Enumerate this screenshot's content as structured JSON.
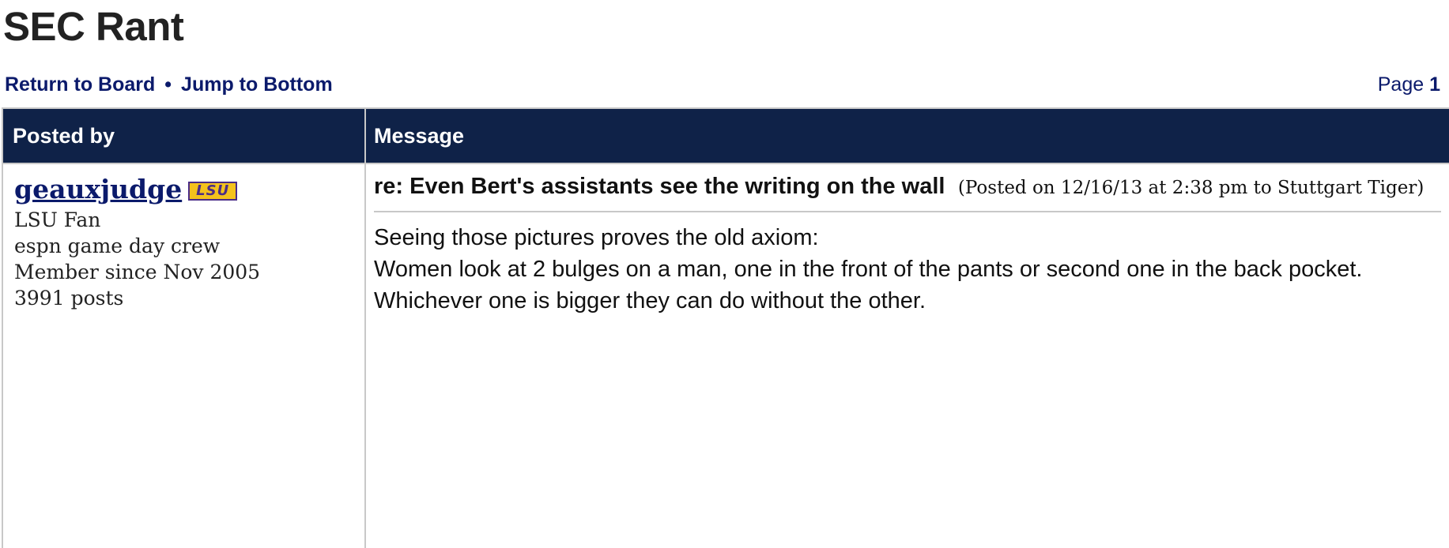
{
  "board": {
    "title": "SEC Rant"
  },
  "nav": {
    "return_label": "Return to Board",
    "separator": "•",
    "jump_label": "Jump to Bottom",
    "page_prefix": "Page",
    "page_number": "1"
  },
  "table": {
    "col_posted_by": "Posted by",
    "col_message": "Message"
  },
  "post": {
    "author": {
      "username": "geauxjudge",
      "team_logo_text": "LSU",
      "team_logo_icon": "lsu-team-logo-icon",
      "fan_of": "LSU Fan",
      "tagline": "espn game day crew",
      "member_since": "Member since Nov 2005",
      "post_count": "3991 posts"
    },
    "subject": "re: Even Bert's assistants see the writing on the wall",
    "meta": "(Posted on 12/16/13 at 2:38 pm to Stuttgart Tiger)",
    "body_lines": [
      "Seeing those pictures proves the old axiom:",
      "Women look at 2 bulges on a man, one in the front of the pants or second one in the back pocket.",
      "Whichever one is bigger they can do without the other."
    ]
  },
  "colors": {
    "header_bg": "#0f2248",
    "link": "#0b1a6b",
    "border": "#c8c8c8",
    "lsu_gold": "#f4c21c",
    "lsu_purple": "#4a2c87"
  }
}
